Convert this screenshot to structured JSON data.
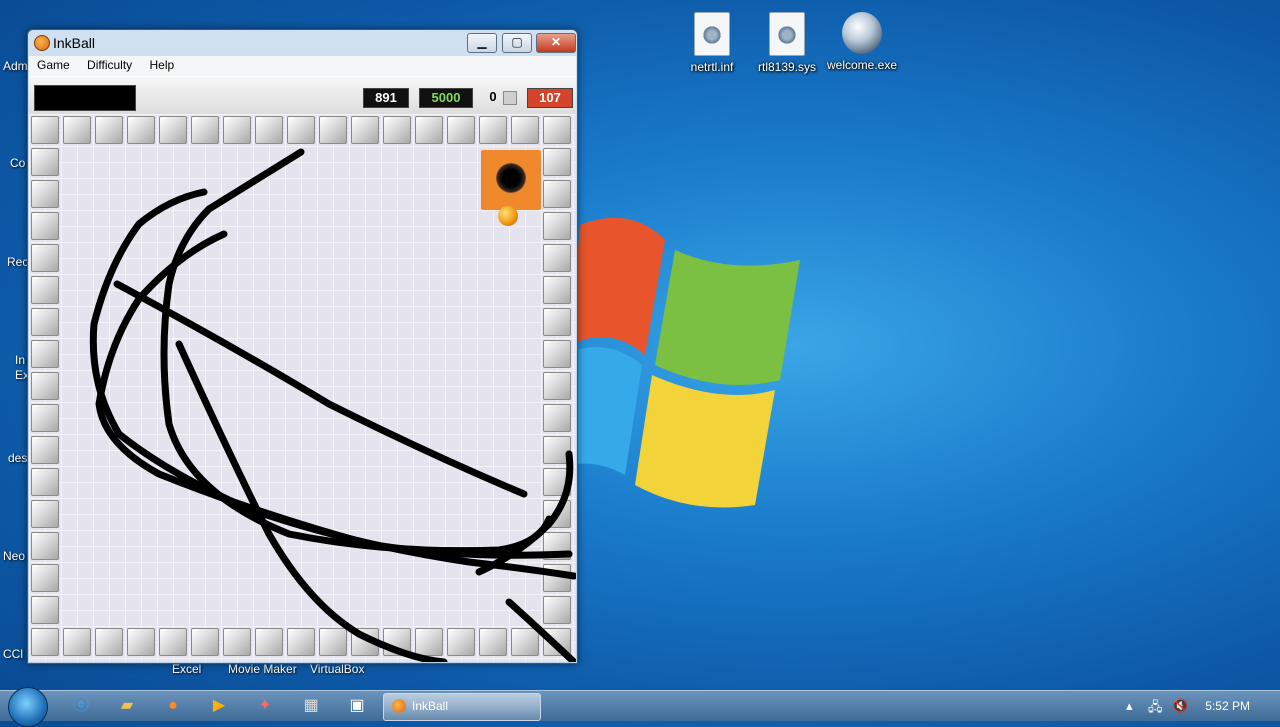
{
  "desktop": {
    "icons": [
      {
        "label": "netrtl.inf",
        "name": "netrtl-file-icon"
      },
      {
        "label": "rtl8139.sys",
        "name": "rtl8139-file-icon"
      },
      {
        "label": "welcome.exe",
        "name": "welcome-exe-icon"
      }
    ],
    "left_labels": [
      "Adm",
      "Co",
      "Rec",
      "In",
      "Ex",
      "des",
      "Neo",
      "CCl"
    ],
    "taskbar_labels": [
      "Excel",
      "Movie Maker",
      "VirtualBox"
    ]
  },
  "window": {
    "title": "InkBall",
    "min_glyph": "▁",
    "max_glyph": "▢",
    "close_glyph": "✕",
    "menu": [
      "Game",
      "Difficulty",
      "Help"
    ],
    "scores": {
      "score": "891",
      "target": "5000",
      "balls_count": "0",
      "time": "107"
    }
  },
  "taskbar": {
    "active_task": "InkBall",
    "clock": "5:52 PM"
  }
}
